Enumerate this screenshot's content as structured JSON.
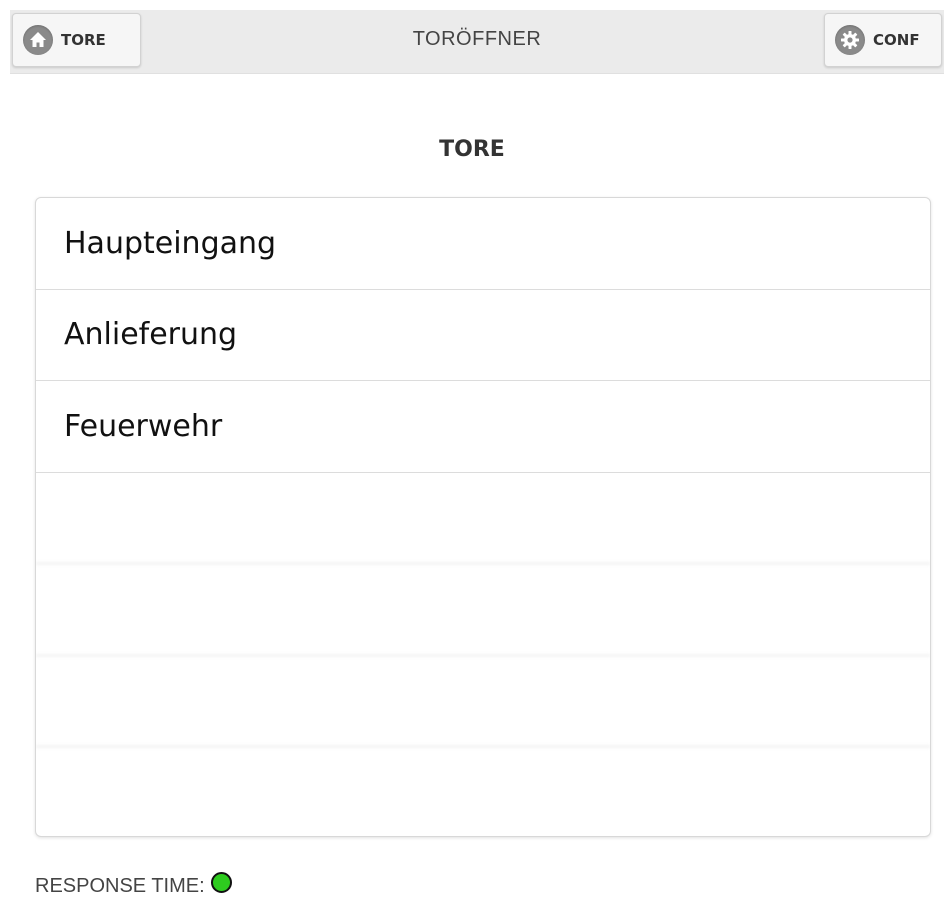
{
  "header": {
    "title": "TORÖFFNER",
    "left_button": {
      "label": "TORE",
      "icon": "home-icon"
    },
    "right_button": {
      "label": "CONF",
      "icon": "gear-icon"
    }
  },
  "section": {
    "title": "TORE"
  },
  "gates": [
    {
      "label": "Haupteingang"
    },
    {
      "label": "Anlieferung"
    },
    {
      "label": "Feuerwehr"
    }
  ],
  "footer": {
    "label": "RESPONSE TIME:",
    "status_color": "#2ecc1f"
  }
}
